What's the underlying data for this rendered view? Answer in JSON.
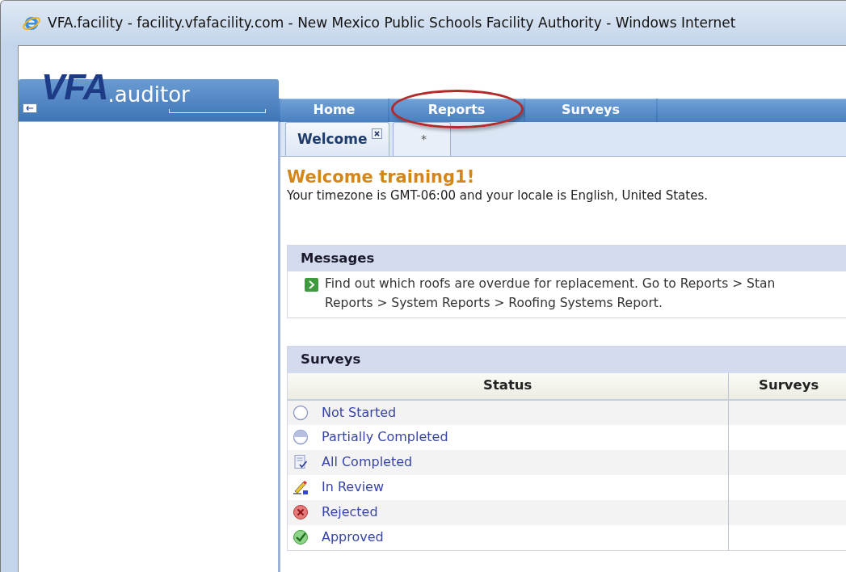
{
  "window": {
    "title": "VFA.facility - facility.vfafacility.com - New Mexico Public Schools Facility Authority - Windows Internet"
  },
  "logo": {
    "brand": "VFA",
    "product": ".auditor"
  },
  "nav_tabs": [
    {
      "label": "Home",
      "circled": false
    },
    {
      "label": "Reports",
      "circled": true
    },
    {
      "label": "Surveys",
      "circled": false
    }
  ],
  "sub_tabs": [
    {
      "label": "Welcome",
      "selected": true,
      "closable": true
    },
    {
      "label": "*",
      "selected": false,
      "closable": false
    }
  ],
  "welcome": {
    "heading": "Welcome training1!",
    "text": "Your timezone is GMT-06:00 and your locale is English, United States."
  },
  "messages": {
    "title": "Messages",
    "lines": [
      "Find out which roofs are overdue for replacement. Go to Reports > Stan",
      "Reports > System Reports > Roofing Systems Report."
    ]
  },
  "surveys": {
    "title": "Surveys",
    "columns": [
      "Status",
      "Surveys"
    ],
    "rows": [
      {
        "kind": "not-started",
        "label": "Not Started"
      },
      {
        "kind": "partial",
        "label": "Partially Completed"
      },
      {
        "kind": "complete",
        "label": "All Completed"
      },
      {
        "kind": "review",
        "label": "In Review"
      },
      {
        "kind": "rejected",
        "label": "Rejected"
      },
      {
        "kind": "approved",
        "label": "Approved"
      }
    ]
  }
}
